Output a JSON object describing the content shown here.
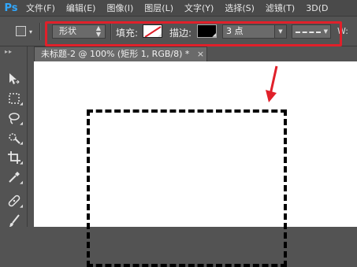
{
  "app": {
    "logo": "Ps"
  },
  "menu": [
    {
      "label": "文件(F)"
    },
    {
      "label": "编辑(E)"
    },
    {
      "label": "图像(I)"
    },
    {
      "label": "图层(L)"
    },
    {
      "label": "文字(Y)"
    },
    {
      "label": "选择(S)"
    },
    {
      "label": "滤镜(T)"
    },
    {
      "label": "3D(D"
    }
  ],
  "options": {
    "mode_value": "形状",
    "fill_label": "填充:",
    "stroke_label": "描边:",
    "stroke_width_value": "3 点",
    "w_label": "W:"
  },
  "document": {
    "tab_title": "未标题-2 @ 100% (矩形 1, RGB/8) *",
    "close": "×"
  },
  "colors": {
    "highlight": "#e0202a",
    "stroke_color": "#000000",
    "fill_color": "none",
    "accent": "#31a8ff"
  }
}
